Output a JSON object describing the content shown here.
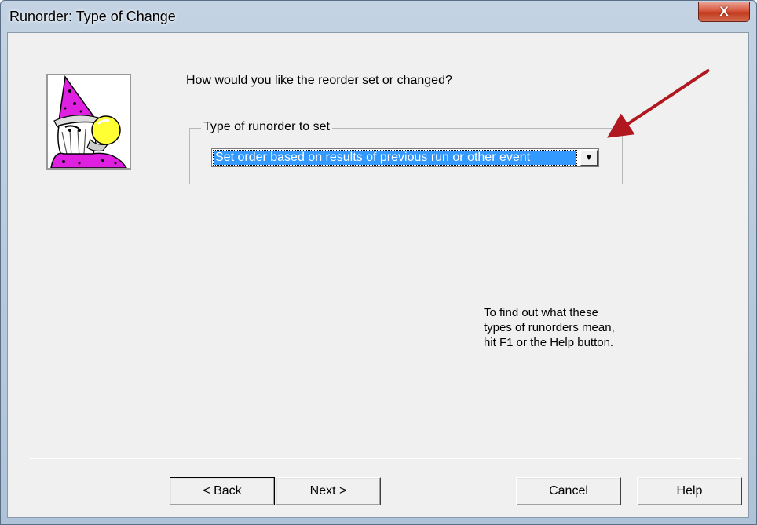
{
  "window": {
    "title": "Runorder: Type of Change",
    "close_glyph": "X"
  },
  "wizard": {
    "question": "How would you like the reorder set or changed?",
    "group_label": "Type of runorder to set",
    "combo_value": "Set order based on results of previous run or other event",
    "combo_arrow": "▼",
    "help_lines": [
      "To find out what these",
      "types of runorders mean,",
      "hit F1 or the Help button."
    ]
  },
  "buttons": {
    "back": "< Back",
    "next": "Next >",
    "cancel": "Cancel",
    "help": "Help"
  },
  "colors": {
    "selection": "#3399ff",
    "annotation_arrow": "#b0171f",
    "close_button": "#c23a1c"
  }
}
